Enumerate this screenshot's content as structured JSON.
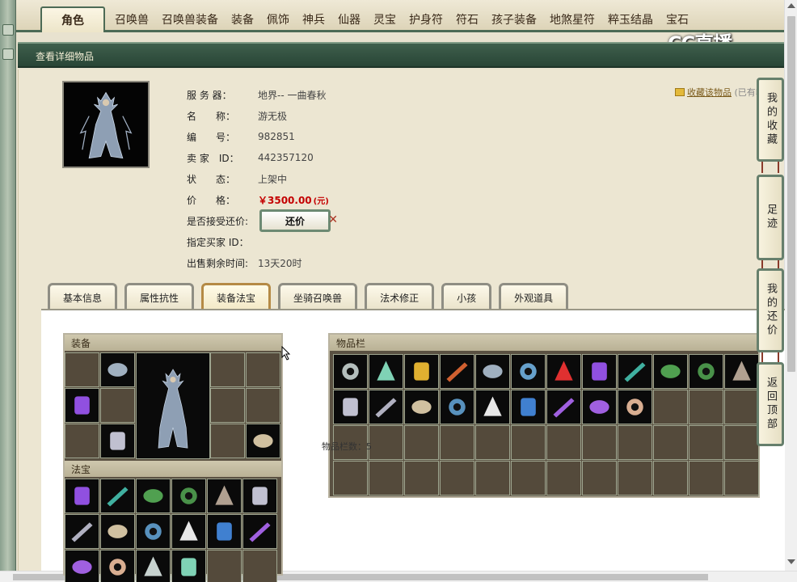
{
  "category_tabs": [
    "角色",
    "召唤兽",
    "召唤兽装备",
    "装备",
    "佩饰",
    "神兵",
    "仙器",
    "灵宝",
    "护身符",
    "符石",
    "孩子装备",
    "地煞星符",
    "粹玉结晶",
    "宝石"
  ],
  "watermark": "CC直播",
  "subheader": "查看详细物品",
  "info": [
    {
      "label": "服 务 器：",
      "value": "地界-- 一曲春秋"
    },
    {
      "label": "名　　称：",
      "value": "游无极"
    },
    {
      "label": "编　　号：",
      "value": "982851"
    },
    {
      "label": "卖 家　ID：",
      "value": "442357120"
    },
    {
      "label": "状　　态：",
      "value": "上架中"
    },
    {
      "label": "价　　格：",
      "value": "￥3500.00",
      "unit": "(元)"
    },
    {
      "label": "是否接受还价:",
      "value": ""
    },
    {
      "label": "指定买家 ID：",
      "value": ""
    },
    {
      "label": "出售剩余时间:",
      "value": "13天20时"
    }
  ],
  "bargain_button": "还价",
  "favorite": {
    "link": "收藏该物品",
    "note": "(已有收"
  },
  "side_tabs": [
    "我的收藏",
    "足迹",
    "我的还价",
    "返回顶部"
  ],
  "detail_tabs": [
    "基本信息",
    "属性抗性",
    "装备法宝",
    "坐骑召唤兽",
    "法术修正",
    "小孩",
    "外观道具"
  ],
  "active_detail_tab": 2,
  "panels": {
    "equipment": "装备",
    "treasure": "法宝",
    "inventory": "物品栏"
  },
  "inventory_count": "物品栏数：5",
  "colors": {
    "accent": "#4c6a55",
    "price": "#c40000"
  }
}
